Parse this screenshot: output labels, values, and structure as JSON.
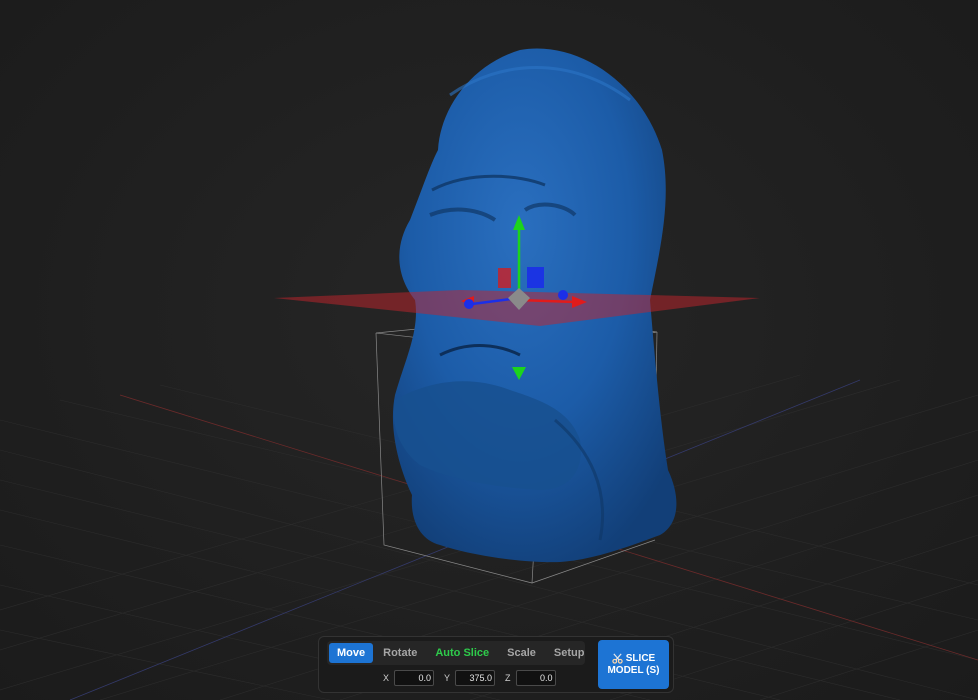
{
  "viewport": {
    "background": "#1f1f1f",
    "model_color": "#1a5aa6",
    "slice_plane_color": "#c4232b",
    "gizmo": {
      "x_color": "#e11b1b",
      "y_color": "#1cd41c",
      "z_color": "#1b2fe8"
    }
  },
  "toolbar": {
    "tabs": [
      {
        "label": "Move",
        "active": true
      },
      {
        "label": "Rotate",
        "active": false
      },
      {
        "label": "Auto Slice",
        "active": false,
        "accent": "#2ecb4b"
      },
      {
        "label": "Scale",
        "active": false
      },
      {
        "label": "Setup",
        "active": false
      }
    ],
    "coords": {
      "x_label": "X",
      "x_value": "0.0",
      "y_label": "Y",
      "y_value": "375.0",
      "z_label": "Z",
      "z_value": "0.0"
    },
    "slice_button": {
      "icon": "scissors-icon",
      "line1": "SLICE",
      "line2": "MODEL (S)"
    },
    "accent_color": "#1d74d4"
  }
}
